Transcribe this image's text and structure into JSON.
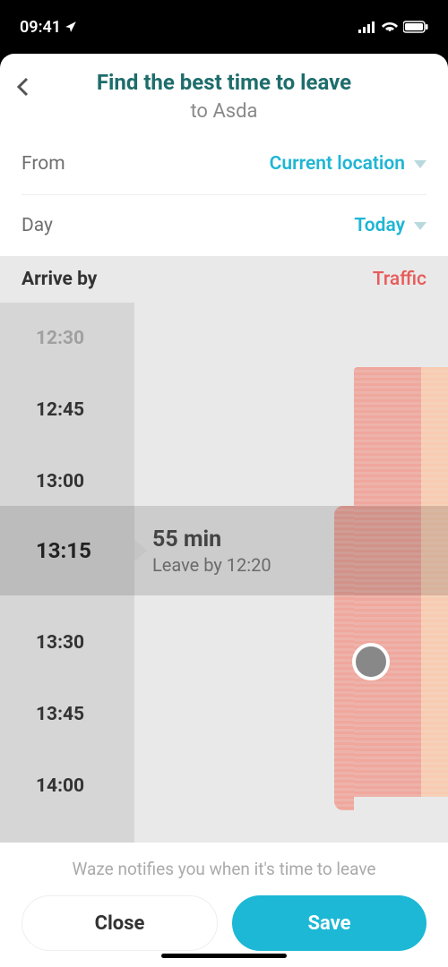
{
  "statusBar": {
    "time": "09:41"
  },
  "header": {
    "title": "Find the best time to leave",
    "subtitle": "to Asda"
  },
  "fields": {
    "fromLabel": "From",
    "fromValue": "Current location",
    "dayLabel": "Day",
    "dayValue": "Today"
  },
  "picker": {
    "arriveLabel": "Arrive by",
    "trafficLabel": "Traffic",
    "times": [
      "12:30",
      "12:45",
      "13:00",
      "13:15",
      "13:30",
      "13:45",
      "14:00"
    ],
    "selected": {
      "time": "13:15",
      "duration": "55 min",
      "leaveBy": "Leave by 12:20"
    }
  },
  "footer": {
    "notice": "Waze notifies you when it's time to leave",
    "closeLabel": "Close",
    "saveLabel": "Save"
  }
}
